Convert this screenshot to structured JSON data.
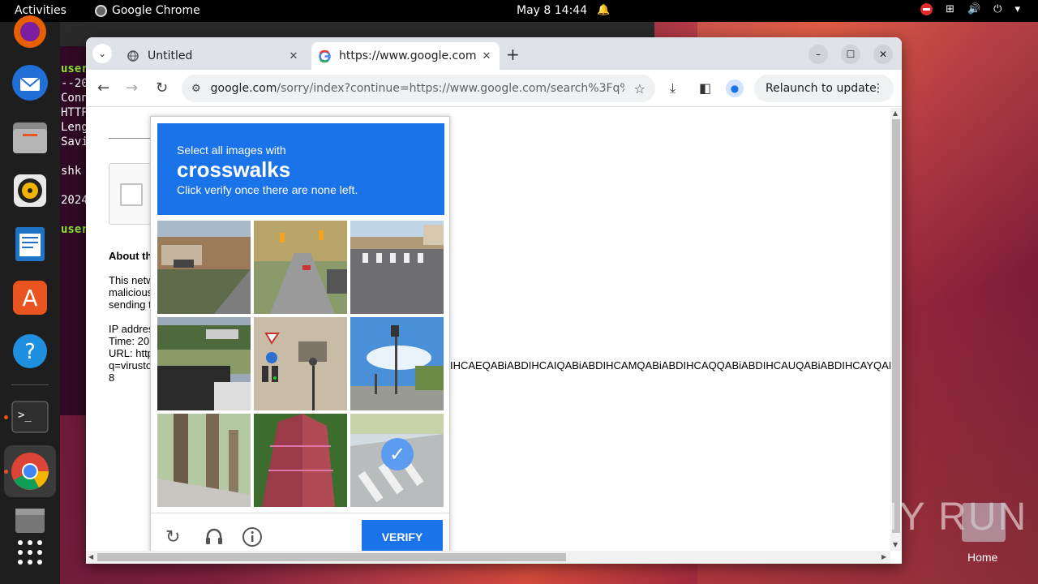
{
  "topbar": {
    "activities": "Activities",
    "app_name": "Google Chrome",
    "clock": "May 8  14:44"
  },
  "dock": {
    "items": [
      "firefox-icon",
      "thunderbird-icon",
      "files-icon",
      "rhythmbox-icon",
      "libreoffice-writer-icon",
      "app-center-icon",
      "help-icon",
      "terminal-icon",
      "chrome-icon",
      "trash-icon",
      "show-apps-icon"
    ]
  },
  "terminal": {
    "lines": [
      "user",
      "--20",
      "Conn",
      "HTTP",
      "Leng",
      "Savi",
      "",
      "shk",
      "",
      "2024",
      "",
      "user"
    ]
  },
  "chrome": {
    "tabs": [
      {
        "title": "Untitled",
        "active": false
      },
      {
        "title": "https://www.google.com",
        "active": true
      }
    ],
    "omnibox": {
      "domain": "google.com",
      "path": "/sorry/index?continue=https://www.google.com/search%3Fq%3D..."
    },
    "relaunch_label": "Relaunch to update"
  },
  "page": {
    "about_heading": "About th",
    "para1": [
      "This netw",
      "malicious",
      "sending t"
    ],
    "para2": [
      "IP addres",
      "Time: 20",
      "URL: http",
      "q=virusto"
    ],
    "url_tail": "IHCAEQABiABDIHCAIQABiABDIHCAMQABiABDIHCAQQABiABDIHCAUQABiABDIHCAYQAB",
    "trailing": "8"
  },
  "captcha": {
    "line1": "Select all images with",
    "keyword": "crosswalks",
    "line3": "Click verify once there are none left.",
    "verify_label": "VERIFY",
    "tiles": [
      {
        "desc": "street with houses",
        "selected": false
      },
      {
        "desc": "traffic lights street",
        "selected": false
      },
      {
        "desc": "crosswalk road",
        "selected": false
      },
      {
        "desc": "cars parked",
        "selected": false
      },
      {
        "desc": "sign on wall",
        "selected": false
      },
      {
        "desc": "traffic light sky",
        "selected": false
      },
      {
        "desc": "tree trunks",
        "selected": false
      },
      {
        "desc": "red bridge",
        "selected": false
      },
      {
        "desc": "crosswalk road",
        "selected": true
      }
    ]
  },
  "watermark": "ANY RUN",
  "home_label": "Home",
  "colors": {
    "captcha_blue": "#1a73e8",
    "terminal_bg": "#300a24",
    "ubuntu_orange": "#e95420"
  }
}
